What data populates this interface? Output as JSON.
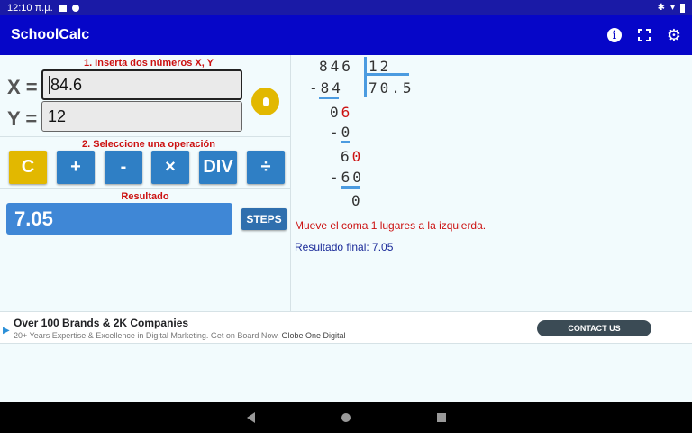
{
  "status": {
    "time": "12:10 π.μ."
  },
  "app": {
    "title": "SchoolCalc"
  },
  "inputs": {
    "heading": "1. Inserta dos números X, Y",
    "x_label": "X =",
    "y_label": "Y =",
    "x_value": "84.6",
    "y_value": "12"
  },
  "operations": {
    "heading": "2. Seleccione una operación",
    "buttons": [
      "C",
      "+",
      "-",
      "×",
      "DIV",
      "÷"
    ]
  },
  "result": {
    "heading": "Resultado",
    "value": "7.05",
    "steps_label": "STEPS"
  },
  "division": {
    "dividend": "846",
    "divisor": "12",
    "quotient": "70.5",
    "sub1": "-84",
    "rem1_a": "0",
    "rem1_b": "6",
    "sub2": "-0",
    "rem2_a": "6",
    "rem2_b": "0",
    "sub3": "-60",
    "final_rem": "0"
  },
  "messages": {
    "comma": "Mueve el coma 1 lugares a la izquierda.",
    "final": "Resultado final: 7.05"
  },
  "ad": {
    "title": "Over 100 Brands & 2K Companies",
    "subtitle_pre": "20+ Years Expertise & Excellence in Digital Marketing. Get on Board Now.",
    "subtitle_brand": "Globe One Digital",
    "cta": "CONTACT US"
  },
  "colors": {
    "appbar": "#0606c8",
    "accent_yellow": "#e2b800",
    "button_blue": "#2f7fc5",
    "red": "#cc1111"
  }
}
